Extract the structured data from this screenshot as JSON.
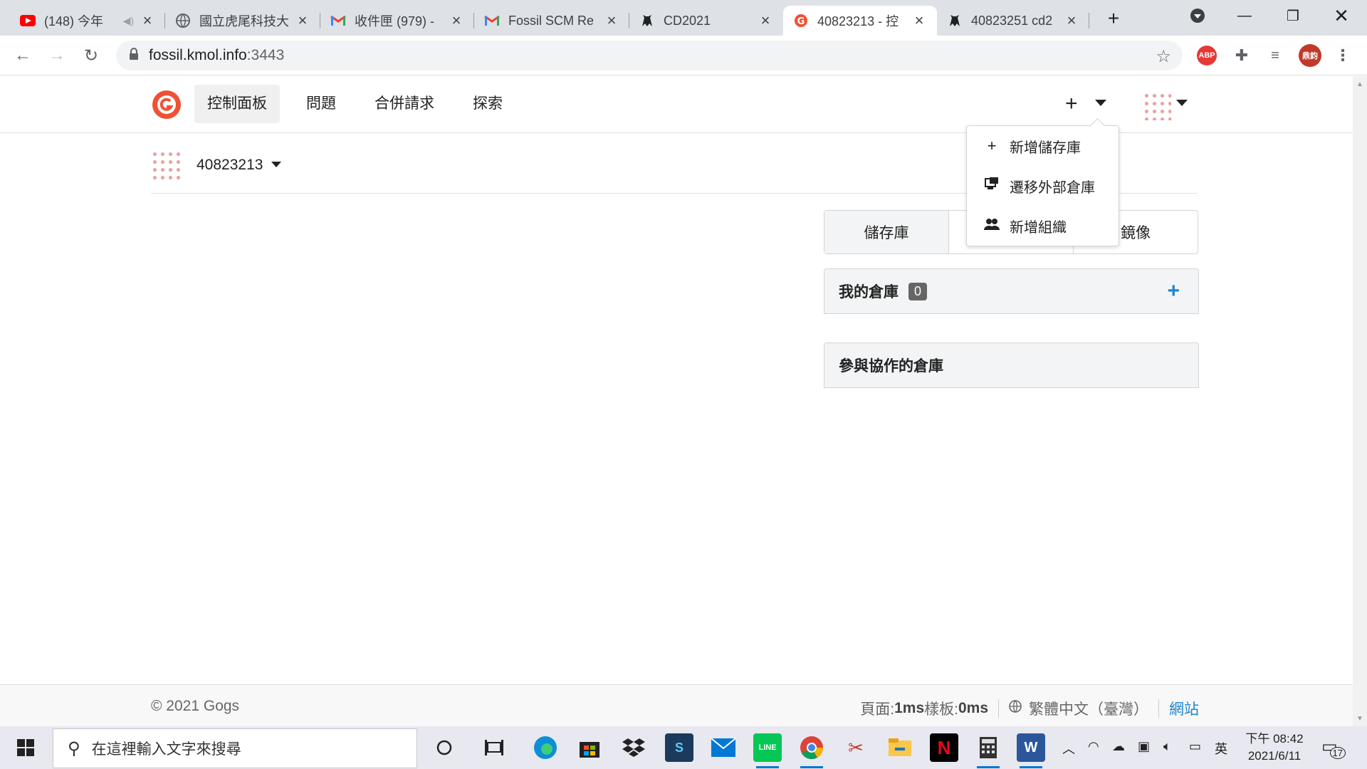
{
  "browser": {
    "tabs": [
      {
        "title": "(148) 今年",
        "favicon": "youtube-icon",
        "color": "#ff0000"
      },
      {
        "title": "國立虎尾科技大",
        "favicon": "globe-icon",
        "color": "#5f6368"
      },
      {
        "title": "收件匣 (979) - ",
        "favicon": "gmail-icon",
        "color": "#ea4335"
      },
      {
        "title": "Fossil SCM Re",
        "favicon": "gmail-icon",
        "color": "#ea4335"
      },
      {
        "title": "CD2021",
        "favicon": "github-icon",
        "color": "#202124"
      },
      {
        "title": "40823213 - 控",
        "favicon": "gogs-icon",
        "color": "#f05133"
      },
      {
        "title": "40823251 cd2",
        "favicon": "github-icon",
        "color": "#202124"
      }
    ],
    "new_tab_glyph": "+",
    "url_host": "fossil.kmol.info",
    "url_port": ":3443",
    "profile_initials": "鼎鈞",
    "abp_label": "ABP"
  },
  "gogs": {
    "nav": {
      "dashboard": "控制面板",
      "issues": "問題",
      "pulls": "合併請求",
      "explore": "探索"
    },
    "context_user": "40823213",
    "create_menu": {
      "new_repo": "新增儲存庫",
      "migrate": "遷移外部倉庫",
      "new_org": "新增組織"
    },
    "repo_tabs": [
      "儲存庫",
      "",
      "鏡像"
    ],
    "my_repos": {
      "title": "我的倉庫",
      "count": "0"
    },
    "collab_repos": {
      "title": "參與協作的倉庫"
    },
    "footer": {
      "copyright": "© 2021 Gogs",
      "page_label": "頁面: ",
      "page_time": "1ms",
      "tpl_label": " 樣板: ",
      "tpl_time": "0ms",
      "language": "繁體中文（臺灣）",
      "website": "網站"
    },
    "accent_color": "#2185d0"
  },
  "taskbar": {
    "search_placeholder": "在這裡輸入文字來搜尋",
    "ime": "英",
    "time": "下午 08:42",
    "date": "2021/6/11",
    "notifications": "17"
  }
}
